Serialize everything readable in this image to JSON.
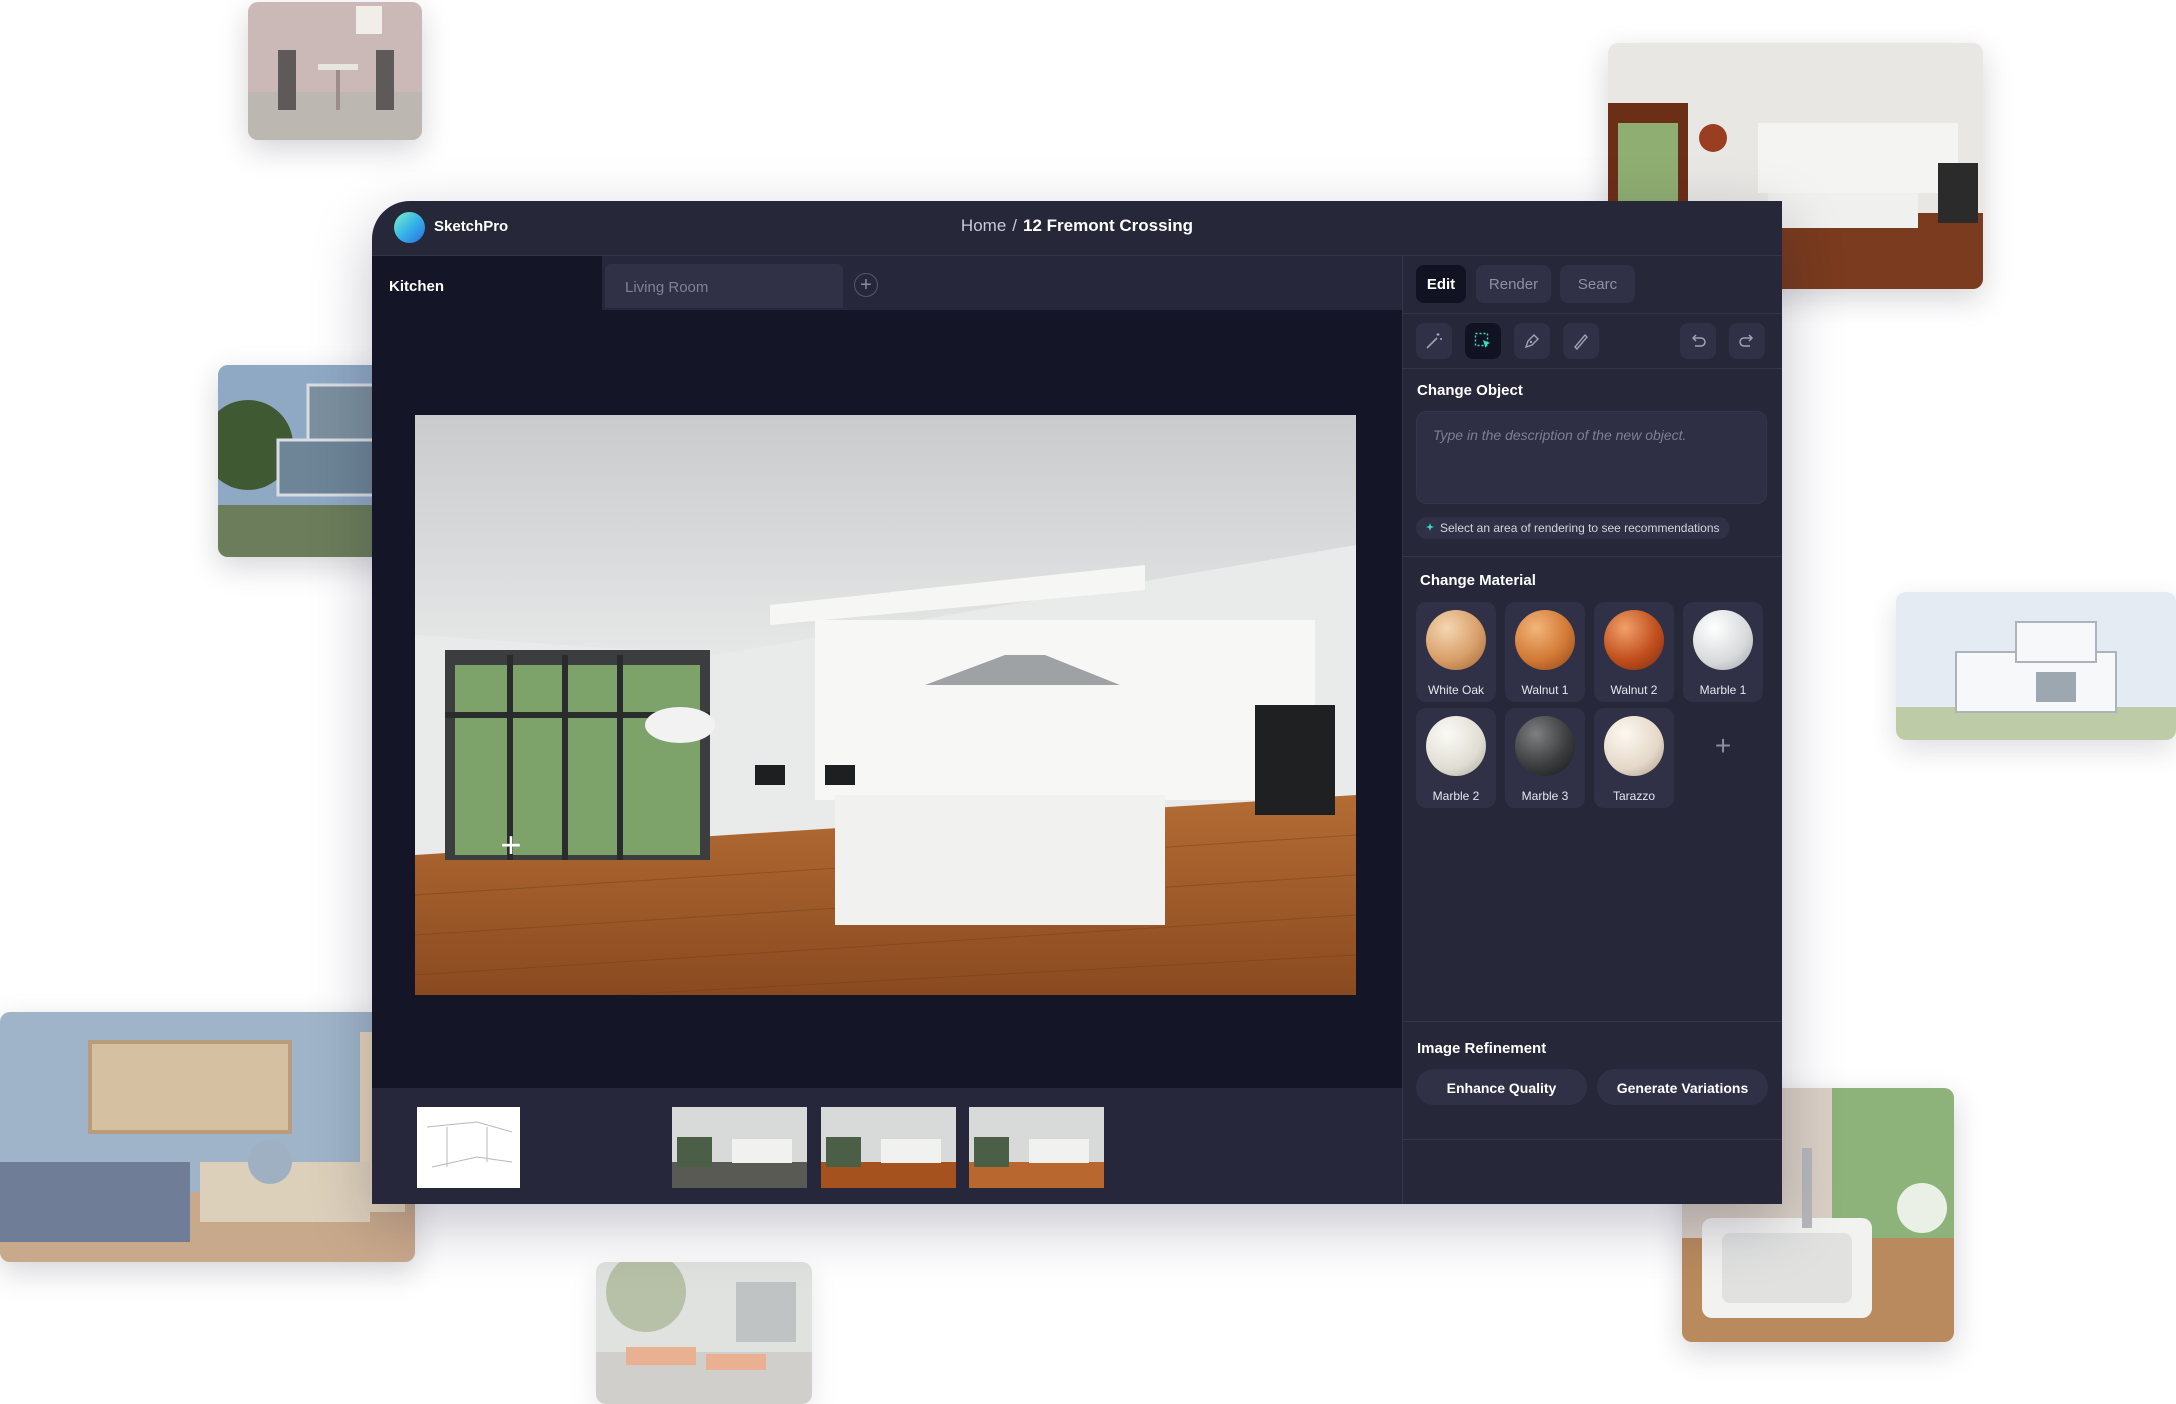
{
  "app": {
    "name": "SketchPro"
  },
  "breadcrumb": {
    "root": "Home",
    "separator": "/",
    "current": "12 Fremont Crossing"
  },
  "room_tabs": {
    "active": "Kitchen",
    "inactive": "Living Room",
    "add": "+"
  },
  "canvas": {
    "add_marker": "+"
  },
  "panel": {
    "modes": [
      "Edit",
      "Render",
      "Searc"
    ],
    "change_object": {
      "title": "Change Object",
      "placeholder": "Type in the description of the new object.",
      "hint": "Select an area of rendering to see recommendations"
    },
    "change_material": {
      "title": "Change Material",
      "materials": [
        "White Oak",
        "Walnut 1",
        "Walnut 2",
        "Marble 1",
        "Marble 2",
        "Marble 3",
        "Tarazzo"
      ],
      "add": "+"
    },
    "image_refinement": {
      "title": "Image Refinement",
      "enhance": "Enhance Quality",
      "variations": "Generate Variations"
    }
  },
  "colors": {
    "app_bg": "#262739",
    "canvas_bg": "#141526",
    "accent": "#36e0c0"
  }
}
